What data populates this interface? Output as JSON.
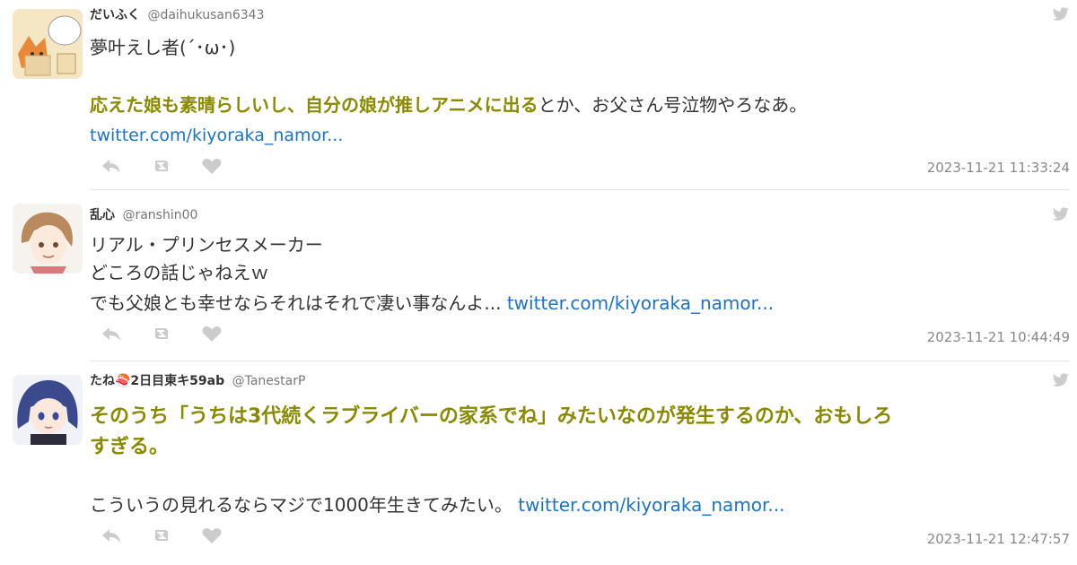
{
  "tweets": [
    {
      "name": "だいふく",
      "handle": "@daihukusan6343",
      "line1": "夢叶えし者(´･ω･)",
      "highlight": "応えた娘も素晴らしいし、自分の娘が推しアニメに出る",
      "rest": "とか、お父さん号泣物やろなあ。",
      "link": "twitter.com/kiyoraka_namor...",
      "timestamp": "2023-11-21 11:33:24"
    },
    {
      "name": "乱心",
      "handle": "@ranshin00",
      "line1": "リアル・プリンセスメーカー",
      "line2": "どころの話じゃねえｗ",
      "line3": "でも父娘とも幸せならそれはそれで凄い事なんよ... ",
      "link": "twitter.com/kiyoraka_namor...",
      "timestamp": "2023-11-21 10:44:49"
    },
    {
      "name": "たね🍣2日目東キ59ab",
      "handle": "@TanestarP",
      "highlight1": "そのうち「うちは3代続くラブライバーの家系でね」みたいなのが発生するのか、おもしろ",
      "highlight2": "すぎる。",
      "line3": "こういうの見れるならマジで1000年生きてみたい。 ",
      "link": "twitter.com/kiyoraka_namor...",
      "timestamp": "2023-11-21 12:47:57"
    }
  ],
  "icons": {
    "reply": "reply-icon",
    "retweet": "retweet-icon",
    "like": "heart-icon",
    "source": "twitter-bird-icon"
  },
  "colors": {
    "highlight": "#8a8a00",
    "link": "#1a73c8",
    "timestamp": "#888888",
    "icon": "#cccccc"
  }
}
